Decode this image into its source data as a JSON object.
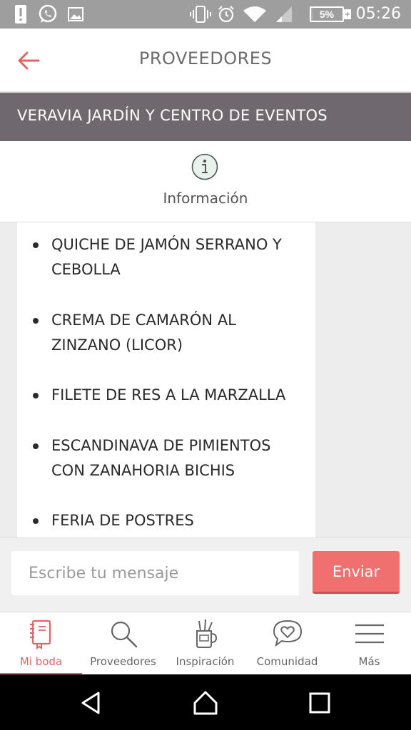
{
  "status_bar": {
    "time": "05:26",
    "battery_percent": "5%",
    "battery_level": 0.05,
    "charging_symbol": "+",
    "icons": [
      "alert-icon",
      "whatsapp-icon",
      "image-icon",
      "vibrate-icon",
      "alarm-icon",
      "wifi-icon",
      "signal-icon",
      "battery-icon"
    ]
  },
  "header": {
    "title": "PROVEEDORES",
    "back_icon": "back-arrow-icon",
    "accent_color": "#e06464"
  },
  "vendor": {
    "name": "VERAVIA JARDÍN Y CENTRO DE EVENTOS"
  },
  "info_tab": {
    "icon": "info-icon",
    "label": "Información"
  },
  "menu_items": [
    "QUICHE DE JAMÓN SERRANO Y CEBOLLA",
    "CREMA DE CAMARÓN AL ZINZANO (LICOR)",
    "FILETE DE RES A LA MARZALLA",
    "ESCANDINAVA DE PIMIENTOS CON ZANAHORIA BICHIS",
    "FERIA DE POSTRES"
  ],
  "composer": {
    "placeholder": "Escribe tu mensaje",
    "value": "",
    "send_label": "Enviar",
    "send_color": "#f07070"
  },
  "tabs": [
    {
      "label": "Mi boda",
      "icon": "notebook-icon",
      "active": true
    },
    {
      "label": "Proveedores",
      "icon": "search-icon",
      "active": false
    },
    {
      "label": "Inspiración",
      "icon": "pencil-cup-icon",
      "active": false
    },
    {
      "label": "Comunidad",
      "icon": "chat-heart-icon",
      "active": false
    },
    {
      "label": "Más",
      "icon": "menu-icon",
      "active": false
    }
  ],
  "nav_bar": {
    "icons": [
      "back-triangle-icon",
      "home-icon",
      "recents-icon"
    ]
  }
}
